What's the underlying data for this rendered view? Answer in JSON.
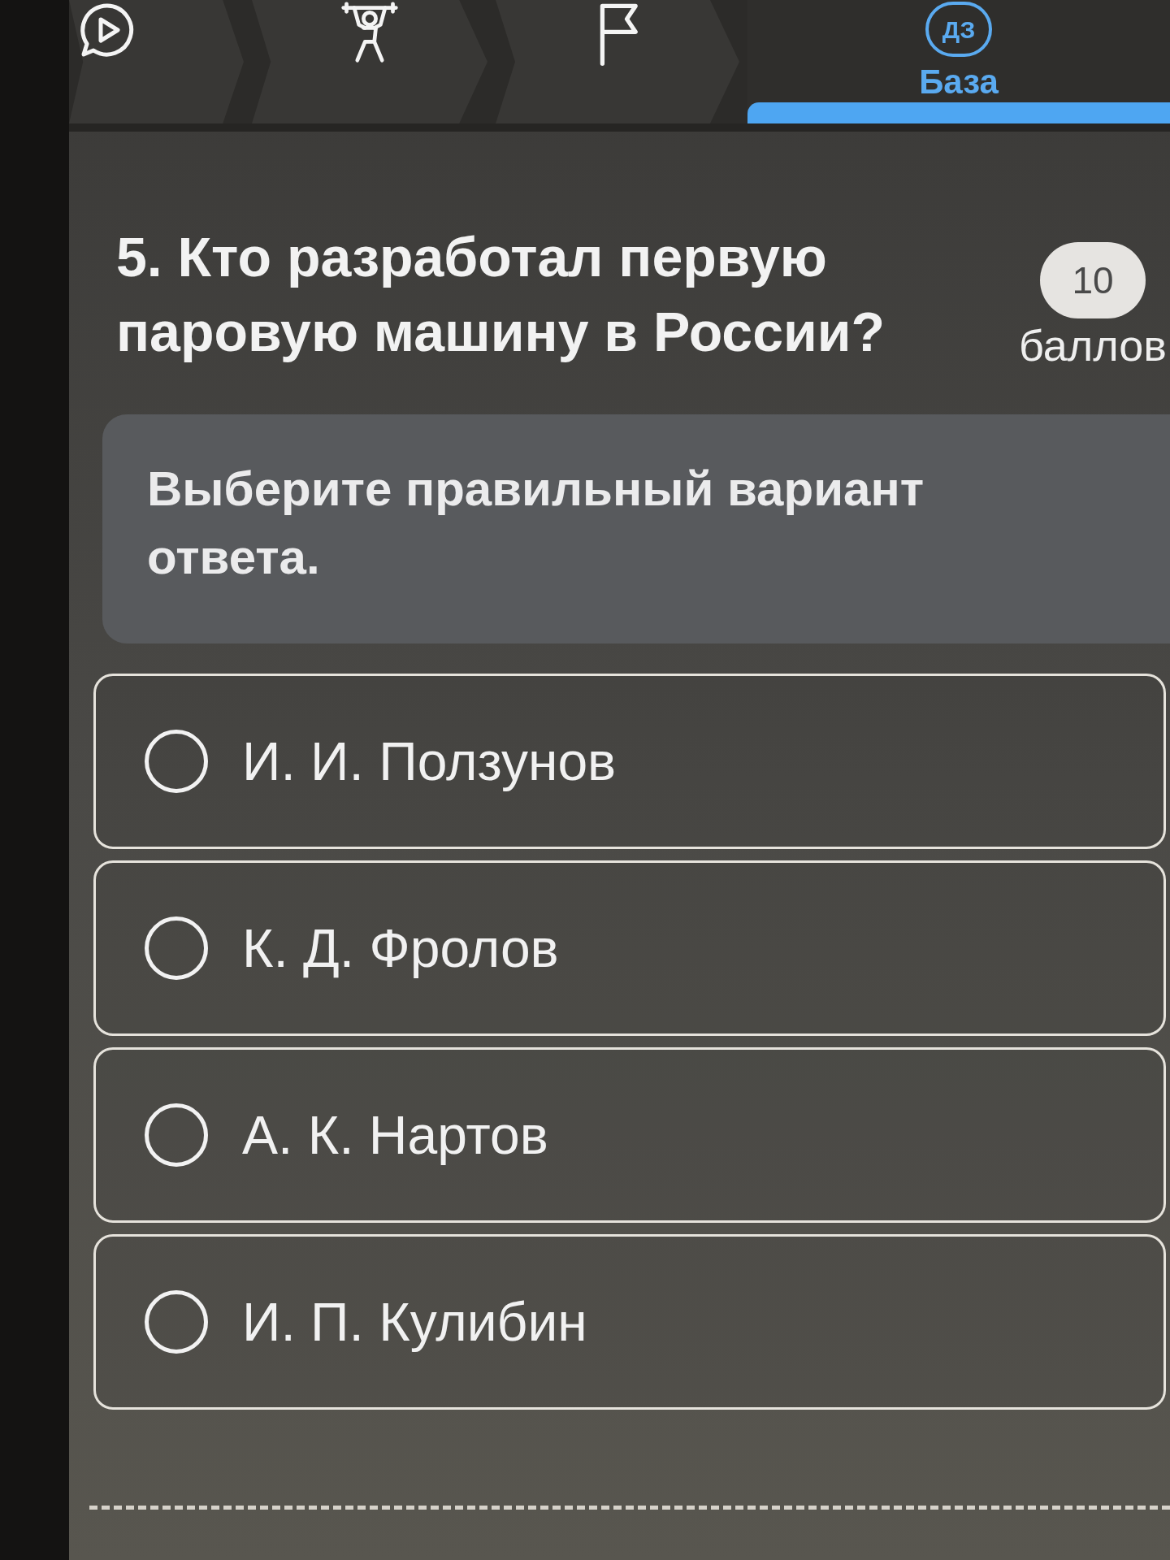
{
  "tabs": [
    {
      "kind": "video",
      "selected": false
    },
    {
      "kind": "workout",
      "selected": false
    },
    {
      "kind": "flag",
      "selected": false
    },
    {
      "kind": "homework",
      "badge": "ДЗ",
      "label": "База",
      "selected": true
    }
  ],
  "question": {
    "text": "5. Кто разработал первую паровую машину в России?",
    "points": "10",
    "points_label": "баллов"
  },
  "instruction": "Выберите правильный вариант ответа.",
  "options": [
    {
      "label": "И. И. Ползунов",
      "selected": false
    },
    {
      "label": "К. Д. Фролов",
      "selected": false
    },
    {
      "label": "А. К. Нартов",
      "selected": false
    },
    {
      "label": "И. П. Кулибин",
      "selected": false
    }
  ]
}
